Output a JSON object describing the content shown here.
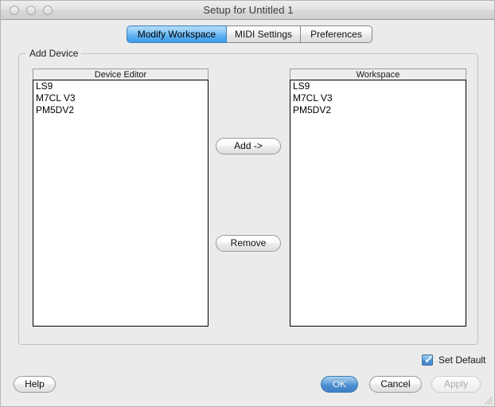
{
  "window": {
    "title": "Setup for Untitled 1",
    "traffic_lights": [
      {
        "name": "close",
        "label": ""
      },
      {
        "name": "minimize",
        "label": ""
      },
      {
        "name": "zoom",
        "label": ""
      }
    ]
  },
  "tabs": [
    {
      "label": "Modify Workspace",
      "active": true
    },
    {
      "label": "MIDI Settings",
      "active": false
    },
    {
      "label": "Preferences",
      "active": false
    }
  ],
  "group": {
    "label": "Add Device"
  },
  "lists": {
    "device_editor": {
      "header": "Device Editor",
      "items": [
        "LS9",
        "M7CL V3",
        "PM5DV2"
      ]
    },
    "workspace": {
      "header": "Workspace",
      "items": [
        "LS9",
        "M7CL V3",
        "PM5DV2"
      ]
    }
  },
  "transfer_buttons": {
    "add": "Add ->",
    "remove": "Remove"
  },
  "options": {
    "set_default_label": "Set Default",
    "set_default_checked": true,
    "checkmark": "✓"
  },
  "footer": {
    "help": "Help",
    "ok": "OK",
    "cancel": "Cancel",
    "apply": "Apply",
    "apply_enabled": false
  },
  "colors": {
    "accent_blue": "#4e8fd2",
    "active_tab_blue": "#5db0f0",
    "window_bg": "#ebebeb",
    "list_bg": "#ffffff",
    "disabled_text": "#aaaaaa"
  }
}
